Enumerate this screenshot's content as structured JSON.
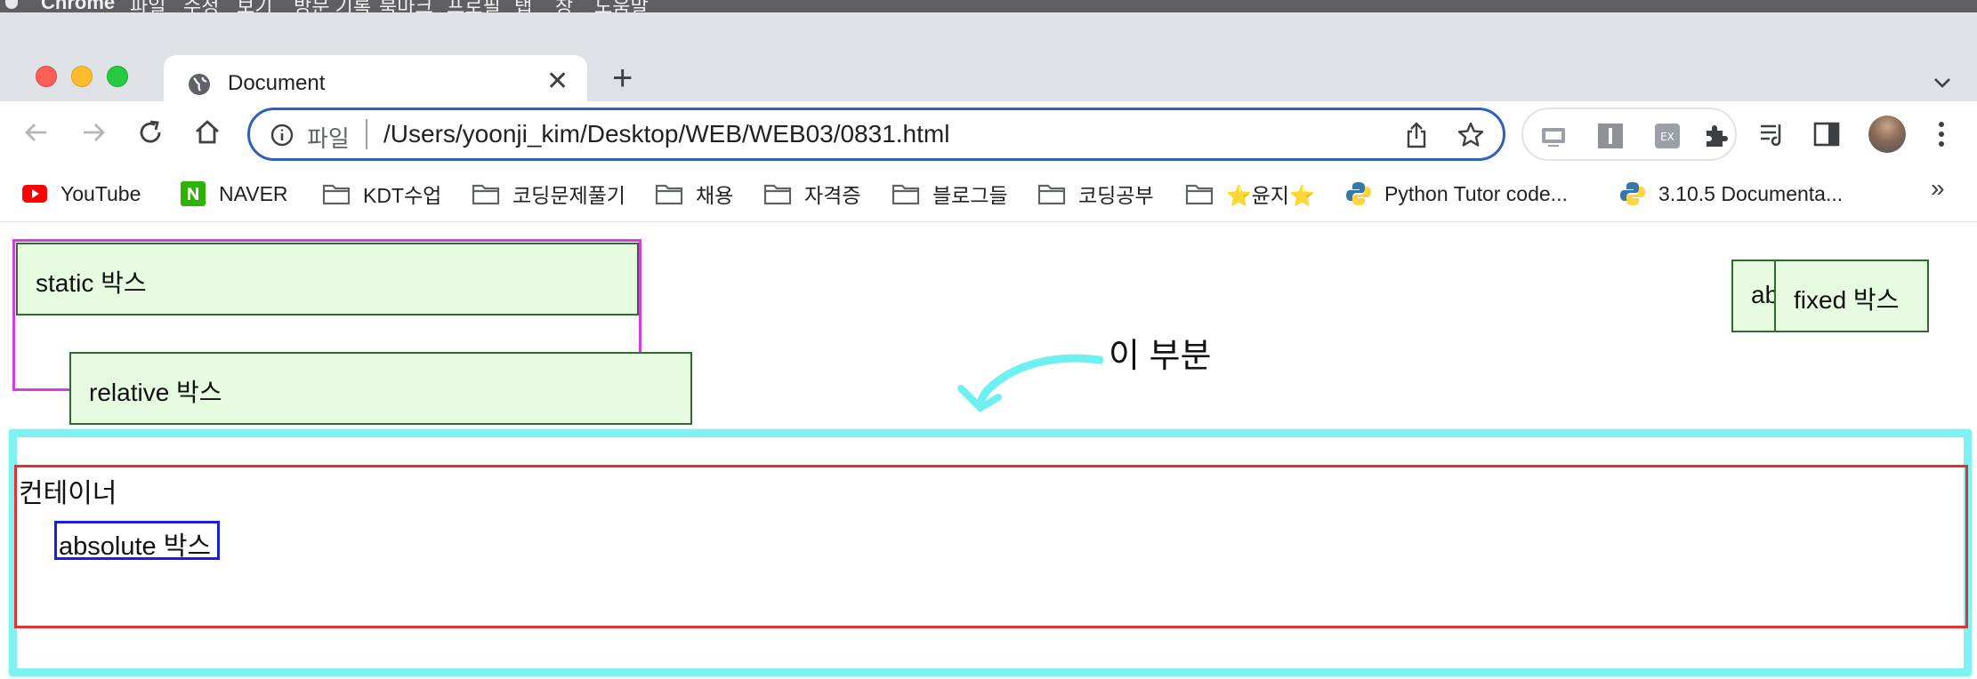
{
  "menubar": {
    "app": "Chrome",
    "items": [
      "파일",
      "수정",
      "보기",
      "방문 기록",
      "북마크",
      "프로필",
      "탭",
      "창",
      "도움말"
    ]
  },
  "tabs": [
    {
      "title": "Document",
      "icon": "globe-icon",
      "active": true
    }
  ],
  "toolbar": {
    "scheme_label": "파일",
    "url": "/Users/yoonji_kim/Desktop/WEB/WEB03/0831.html"
  },
  "bookmarks": [
    {
      "label": "YouTube",
      "icon": "youtube-icon"
    },
    {
      "label": "NAVER",
      "icon": "naver-icon"
    },
    {
      "label": "KDT수업",
      "icon": "folder-icon"
    },
    {
      "label": "코딩문제풀기",
      "icon": "folder-icon"
    },
    {
      "label": "채용",
      "icon": "folder-icon"
    },
    {
      "label": "자격증",
      "icon": "folder-icon"
    },
    {
      "label": "블로그들",
      "icon": "folder-icon"
    },
    {
      "label": "코딩공부",
      "icon": "folder-icon"
    },
    {
      "label": "⭐윤지⭐",
      "icon": "folder-icon"
    },
    {
      "label": "Python Tutor code...",
      "icon": "python-icon"
    },
    {
      "label": "3.10.5 Documenta...",
      "icon": "python-icon"
    }
  ],
  "page": {
    "static_label": "static 박스",
    "relative_label": "relative 박스",
    "abs_right_label": "ab",
    "fixed_label": "fixed 박스",
    "container_label": "컨테이너",
    "absolute_label": "absolute 박스",
    "annotation": "이 부분"
  },
  "colors": {
    "box_fill": "#e6fbdf",
    "box_border": "#2f6b2f",
    "static_wrap_border": "#d63be5",
    "container_border": "#e0322f",
    "absolute_border": "#1d1de0",
    "highlight": "#7ef2f2",
    "omnibox_border": "#2f5fbf"
  }
}
